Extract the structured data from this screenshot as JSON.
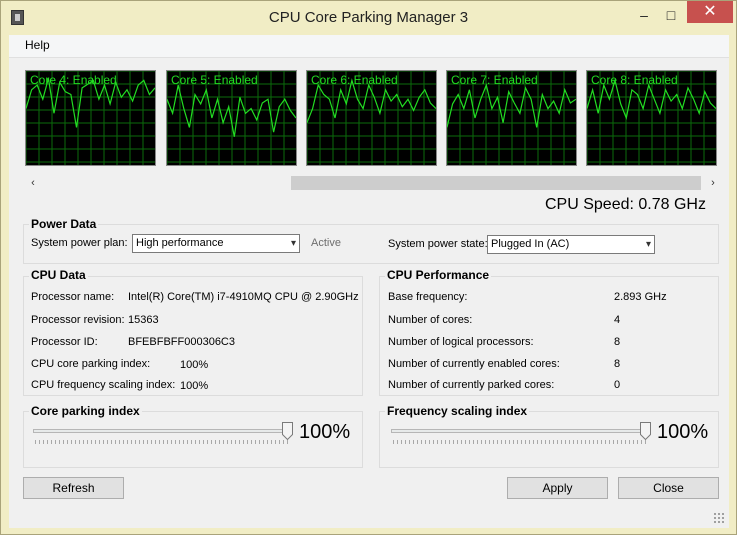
{
  "window": {
    "title": "CPU Core Parking Manager 3",
    "minimize_glyph": "–",
    "maximize_glyph": "□",
    "close_glyph": "✕",
    "colors": {
      "frame": "#f1edc5",
      "close": "#c7514e",
      "graph_line": "#22dd22",
      "graph_bg": "#000000"
    }
  },
  "menu": {
    "help": "Help"
  },
  "cores": [
    {
      "label": "Core 4: Enabled",
      "load": [
        60,
        80,
        85,
        70,
        92,
        55,
        88,
        78,
        75,
        40,
        82,
        86,
        90,
        70,
        85,
        65,
        88,
        72,
        80,
        68,
        85,
        90,
        75,
        82
      ]
    },
    {
      "label": "Core 5: Enabled",
      "load": [
        70,
        55,
        85,
        60,
        40,
        75,
        65,
        80,
        50,
        70,
        45,
        62,
        30,
        72,
        55,
        60,
        48,
        66,
        70,
        35,
        62,
        70,
        58,
        50
      ]
    },
    {
      "label": "Core 6: Enabled",
      "load": [
        45,
        60,
        85,
        75,
        70,
        50,
        80,
        65,
        90,
        70,
        60,
        85,
        72,
        55,
        80,
        68,
        75,
        62,
        70,
        58,
        72,
        80,
        66,
        60
      ]
    },
    {
      "label": "Core 7: Enabled",
      "load": [
        40,
        65,
        75,
        60,
        80,
        50,
        70,
        85,
        60,
        72,
        45,
        78,
        66,
        55,
        82,
        70,
        40,
        75,
        60,
        68,
        55,
        80,
        66,
        70
      ]
    },
    {
      "label": "Core 8: Enabled",
      "load": [
        60,
        80,
        55,
        85,
        70,
        90,
        65,
        50,
        80,
        75,
        60,
        85,
        70,
        55,
        80,
        68,
        75,
        60,
        82,
        70,
        55,
        78,
        66,
        60
      ]
    }
  ],
  "cpu_speed": "CPU Speed: 0.78 GHz",
  "power_data": {
    "title": "Power Data",
    "plan_label": "System power plan:",
    "plan_value": "High performance",
    "plan_status": "Active",
    "state_label": "System power state:",
    "state_value": "Plugged In (AC)"
  },
  "cpu_data": {
    "title": "CPU Data",
    "rows": [
      {
        "label": "Processor name:",
        "value": "Intel(R) Core(TM) i7-4910MQ CPU @ 2.90GHz"
      },
      {
        "label": "Processor revision:",
        "value": "15363"
      },
      {
        "label": "Processor ID:",
        "value": "BFEBFBFF000306C3"
      },
      {
        "label": "CPU core parking index:",
        "value": "100%"
      },
      {
        "label": "CPU frequency scaling index:",
        "value": "100%"
      }
    ]
  },
  "cpu_performance": {
    "title": "CPU Performance",
    "rows": [
      {
        "label": "Base frequency:",
        "value": "2.893 GHz"
      },
      {
        "label": "Number of cores:",
        "value": "4"
      },
      {
        "label": "Number of logical processors:",
        "value": "8"
      },
      {
        "label": "Number of currently enabled cores:",
        "value": "8"
      },
      {
        "label": "Number of currently parked cores:",
        "value": "0"
      }
    ]
  },
  "core_parking": {
    "title": "Core parking index",
    "value_text": "100%",
    "value_fraction": 1.0
  },
  "frequency_scaling": {
    "title": "Frequency scaling index",
    "value_text": "100%",
    "value_fraction": 1.0
  },
  "buttons": {
    "refresh": "Refresh",
    "apply": "Apply",
    "close": "Close"
  },
  "icons": {
    "app": "app-icon",
    "dropdown": "▾",
    "scroll_left": "‹",
    "scroll_right": "›"
  }
}
